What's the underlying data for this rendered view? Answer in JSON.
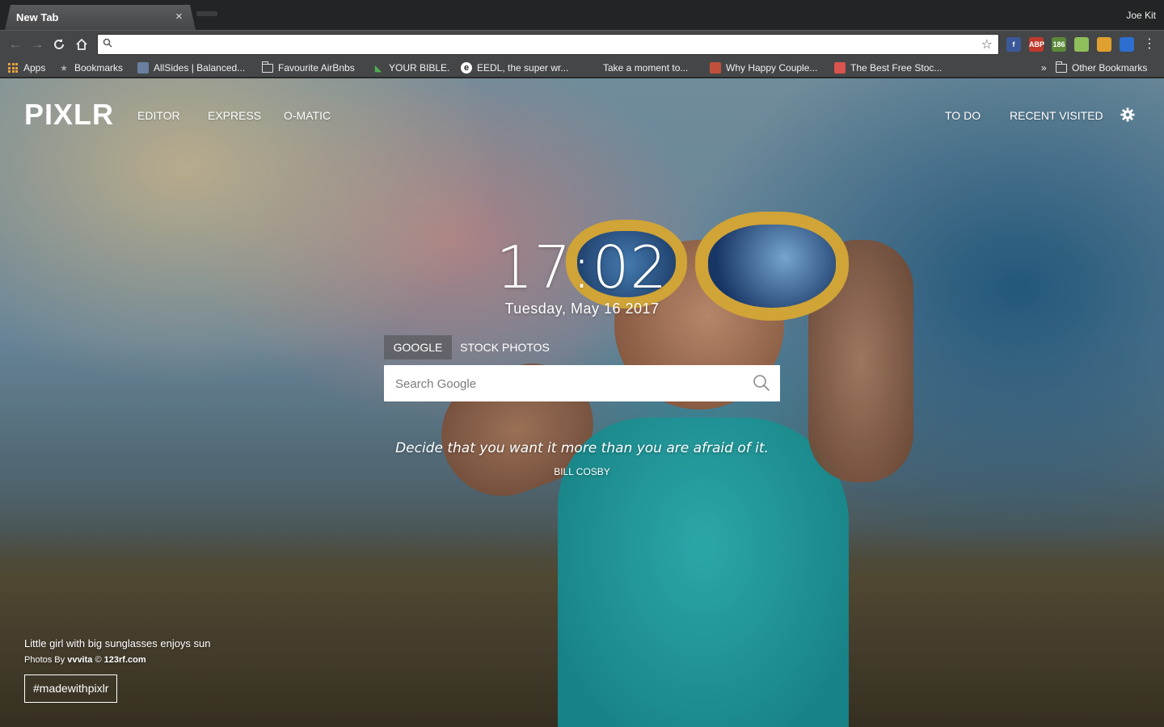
{
  "browser": {
    "tab_title": "New Tab",
    "tab_close": "×",
    "profile": "Joe Kit",
    "address_value": "",
    "bookmarks": [
      {
        "label": "Apps",
        "icon": "apps-grid-icon"
      },
      {
        "label": "Bookmarks",
        "icon": "star-icon"
      },
      {
        "label": "AllSides | Balanced...",
        "icon": "allsides-icon"
      },
      {
        "label": "Favourite AirBnbs",
        "icon": "folder-icon"
      },
      {
        "label": "YOUR BIBLE.",
        "icon": "bible-icon"
      },
      {
        "label": "EEDL, the super wr...",
        "icon": "eedl-icon"
      },
      {
        "label": "Take a moment to...",
        "icon": "blank-icon"
      },
      {
        "label": "Why Happy Couple...",
        "icon": "couple-icon"
      },
      {
        "label": "The Best Free Stoc...",
        "icon": "stock-icon"
      }
    ],
    "bookmarks_overflow": "»",
    "other_bookmarks": "Other Bookmarks",
    "extensions": [
      {
        "name": "facebook-ext-icon",
        "label": "f",
        "color": "#3b5998"
      },
      {
        "name": "adblock-ext-icon",
        "label": "ABP",
        "color": "#c0392b"
      },
      {
        "name": "counter-ext-icon",
        "label": "186",
        "color": "#5c8a3a"
      },
      {
        "name": "translate-ext-icon",
        "label": "",
        "color": "#8fbf5a"
      },
      {
        "name": "arc-ext-icon",
        "label": "",
        "color": "#e0a030"
      },
      {
        "name": "bookmark-ext-icon",
        "label": "",
        "color": "#2d6fd0"
      }
    ]
  },
  "page": {
    "logo": "PIXLR",
    "nav_left": [
      "EDITOR",
      "EXPRESS",
      "O-MATIC"
    ],
    "nav_right": [
      "TO DO",
      "RECENT VISITED"
    ],
    "clock": "17:02",
    "date": "Tuesday, May 16 2017",
    "search_tabs": [
      "GOOGLE",
      "STOCK PHOTOS"
    ],
    "active_search_tab": "GOOGLE",
    "search_placeholder": "Search Google",
    "quote": "Decide that you want it more than you are afraid of it.",
    "quote_author": "BILL COSBY",
    "photo_caption": "Little girl with big sunglasses enjoys sun",
    "credit_prefix": "Photos By",
    "credit_author": "vvvita",
    "credit_sep": "©",
    "credit_site": "123rf.com",
    "hashtag": "#madewithpixlr"
  }
}
